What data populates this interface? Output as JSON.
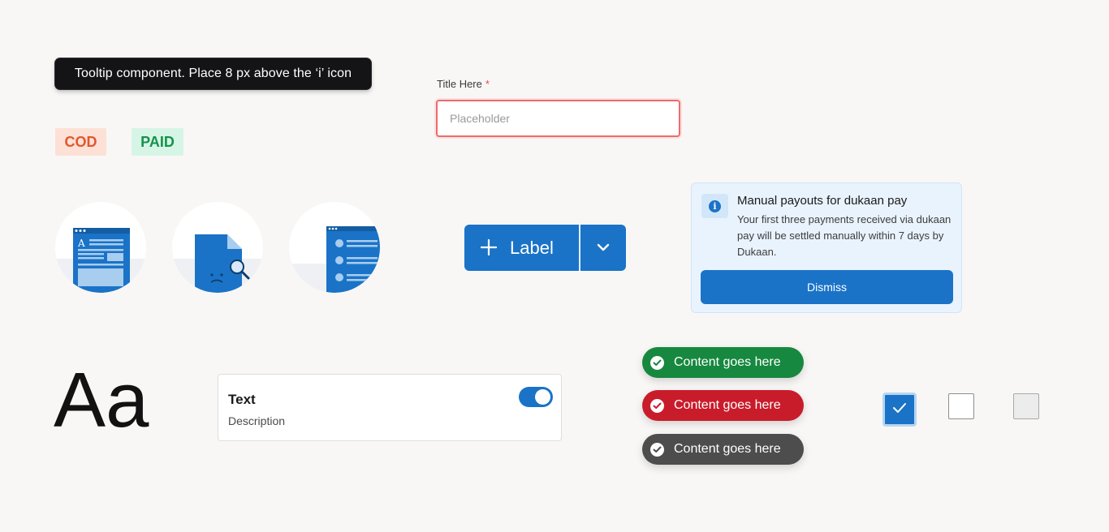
{
  "tooltip": {
    "text": "Tooltip component. Place 8 px above the ‘i’ icon"
  },
  "badges": {
    "cod": "COD",
    "paid": "PAID"
  },
  "form_field": {
    "label": "Title Here",
    "required_mark": "*",
    "placeholder": "Placeholder",
    "value": ""
  },
  "illustrations": [
    "document-illustration",
    "file-not-found-illustration",
    "contact-list-illustration"
  ],
  "split_button": {
    "icon": "plus-icon",
    "label": "Label",
    "dropdown_icon": "chevron-down-icon"
  },
  "info_card": {
    "title": "Manual payouts for dukaan pay",
    "body": "Your first three payments received via dukaan pay will be settled manually within 7 days by Dukaan.",
    "button": "Dismiss",
    "icon": "info-icon"
  },
  "typography_sample": "Aa",
  "toggle_card": {
    "title": "Text",
    "description": "Description",
    "toggle_on": true
  },
  "toasts": [
    {
      "text": "Content goes here",
      "variant": "success",
      "color": "#17883f"
    },
    {
      "text": "Content goes here",
      "variant": "error",
      "color": "#c91c2b"
    },
    {
      "text": "Content goes here",
      "variant": "neutral",
      "color": "#4d4d4d"
    }
  ],
  "checkboxes": [
    {
      "state": "checked"
    },
    {
      "state": "unchecked"
    },
    {
      "state": "disabled"
    }
  ],
  "colors": {
    "primary": "#1a73c7",
    "error_border": "#ef6b6b",
    "background": "#f8f7f5"
  }
}
